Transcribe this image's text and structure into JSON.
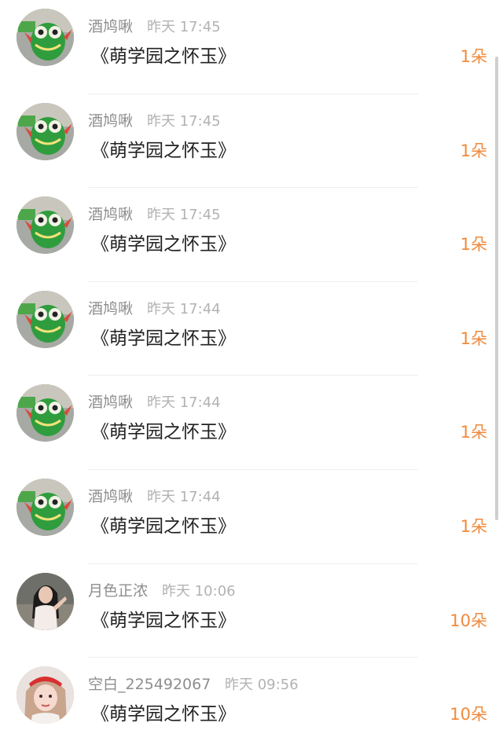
{
  "gift_list": {
    "items": [
      {
        "user": "酒鸠啾",
        "time": "昨天 17:45",
        "title": "《萌学园之怀玉》",
        "count": "1朵",
        "avatar": "green-plush-avatar"
      },
      {
        "user": "酒鸠啾",
        "time": "昨天 17:45",
        "title": "《萌学园之怀玉》",
        "count": "1朵",
        "avatar": "green-plush-avatar"
      },
      {
        "user": "酒鸠啾",
        "time": "昨天 17:45",
        "title": "《萌学园之怀玉》",
        "count": "1朵",
        "avatar": "green-plush-avatar"
      },
      {
        "user": "酒鸠啾",
        "time": "昨天 17:44",
        "title": "《萌学园之怀玉》",
        "count": "1朵",
        "avatar": "green-plush-avatar"
      },
      {
        "user": "酒鸠啾",
        "time": "昨天 17:44",
        "title": "《萌学园之怀玉》",
        "count": "1朵",
        "avatar": "green-plush-avatar"
      },
      {
        "user": "酒鸠啾",
        "time": "昨天 17:44",
        "title": "《萌学园之怀玉》",
        "count": "1朵",
        "avatar": "green-plush-avatar"
      },
      {
        "user": "月色正浓",
        "time": "昨天 10:06",
        "title": "《萌学园之怀玉》",
        "count": "10朵",
        "avatar": "girl-photo-avatar"
      },
      {
        "user": "空白_225492067",
        "time": "昨天 09:56",
        "title": "《萌学园之怀玉》",
        "count": "10朵",
        "avatar": "red-hat-girl-avatar"
      }
    ]
  },
  "colors": {
    "count_accent": "#f08a3c",
    "username": "#8e8e8e",
    "timestamp": "#b2b2b2",
    "title": "#222222"
  }
}
